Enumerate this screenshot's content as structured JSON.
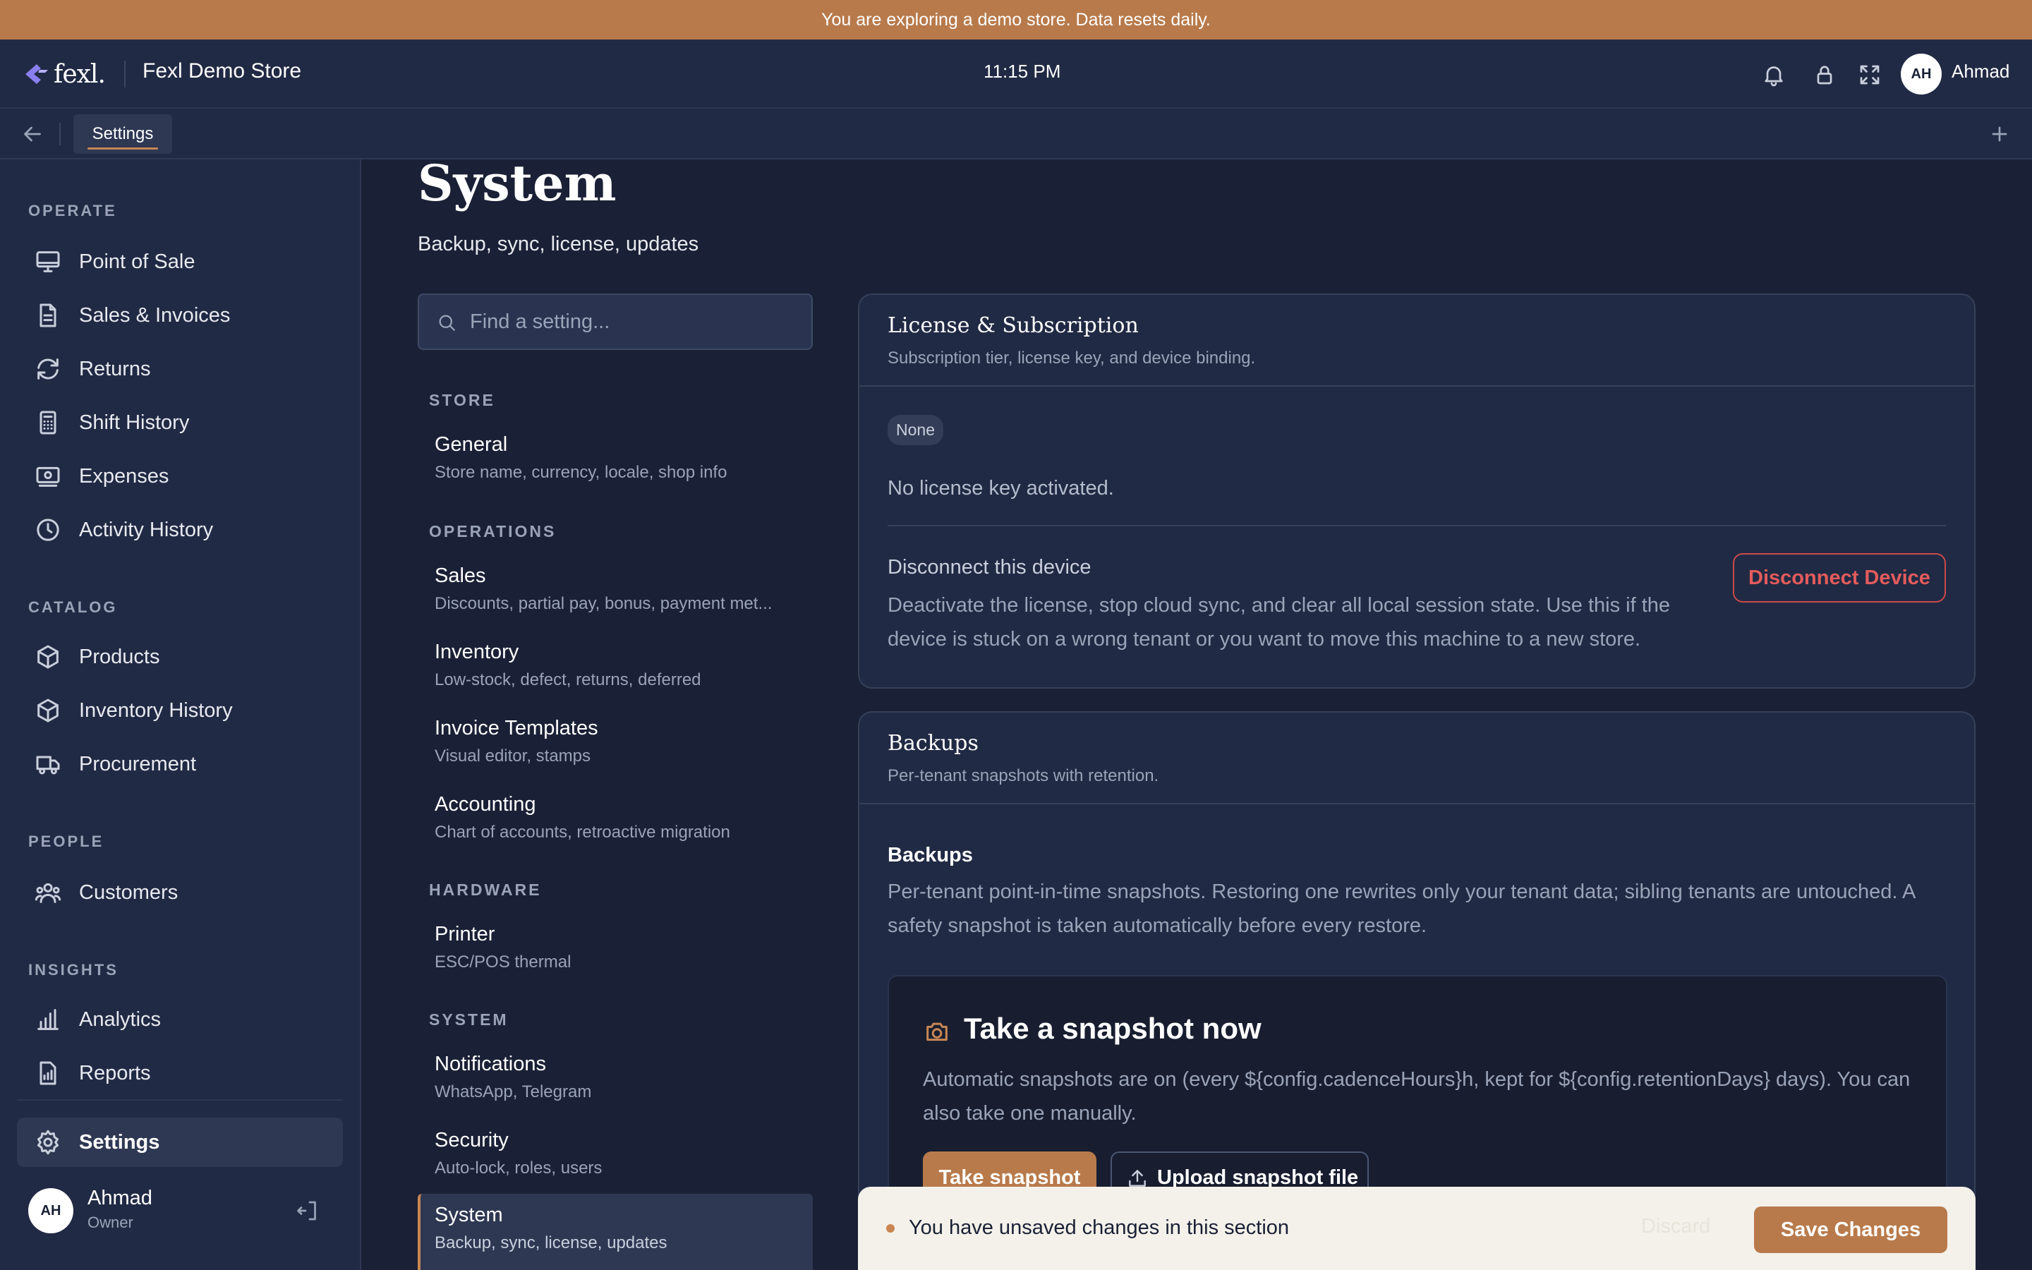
{
  "banner": {
    "text": "You are exploring a demo store. Data resets daily."
  },
  "header": {
    "logo_text": "fexl.",
    "store_name": "Fexl Demo Store",
    "clock": "11:15 PM",
    "user_initials": "AH",
    "user_name": "Ahmad",
    "icons": [
      "bell-icon",
      "lock-icon",
      "fullscreen-icon"
    ]
  },
  "tabbar": {
    "active_tab": "Settings"
  },
  "sidebar": {
    "sections": [
      {
        "title": "OPERATE",
        "items": [
          {
            "label": "Point of Sale",
            "icon": "monitor-icon"
          },
          {
            "label": "Sales & Invoices",
            "icon": "document-icon"
          },
          {
            "label": "Returns",
            "icon": "refresh-icon"
          },
          {
            "label": "Shift History",
            "icon": "calculator-icon"
          },
          {
            "label": "Expenses",
            "icon": "cash-icon"
          },
          {
            "label": "Activity History",
            "icon": "clock-icon"
          }
        ]
      },
      {
        "title": "CATALOG",
        "items": [
          {
            "label": "Products",
            "icon": "box-icon"
          },
          {
            "label": "Inventory History",
            "icon": "box-icon"
          },
          {
            "label": "Procurement",
            "icon": "truck-icon"
          }
        ]
      },
      {
        "title": "PEOPLE",
        "items": [
          {
            "label": "Customers",
            "icon": "users-icon"
          }
        ]
      },
      {
        "title": "INSIGHTS",
        "items": [
          {
            "label": "Analytics",
            "icon": "bar-chart-icon"
          },
          {
            "label": "Reports",
            "icon": "report-icon"
          }
        ]
      }
    ],
    "settings_label": "Settings",
    "user": {
      "initials": "AH",
      "name": "Ahmad",
      "role": "Owner"
    }
  },
  "page": {
    "title": "System",
    "subtitle": "Backup, sync, license, updates"
  },
  "search": {
    "placeholder": "Find a setting..."
  },
  "settings_nav": [
    {
      "category": "STORE",
      "items": [
        {
          "title": "General",
          "desc": "Store name, currency, locale, shop info"
        }
      ]
    },
    {
      "category": "OPERATIONS",
      "items": [
        {
          "title": "Sales",
          "desc": "Discounts, partial pay, bonus, payment met..."
        },
        {
          "title": "Inventory",
          "desc": "Low-stock, defect, returns, deferred"
        },
        {
          "title": "Invoice Templates",
          "desc": "Visual editor, stamps"
        },
        {
          "title": "Accounting",
          "desc": "Chart of accounts, retroactive migration"
        }
      ]
    },
    {
      "category": "HARDWARE",
      "items": [
        {
          "title": "Printer",
          "desc": "ESC/POS thermal"
        }
      ]
    },
    {
      "category": "SYSTEM",
      "items": [
        {
          "title": "Notifications",
          "desc": "WhatsApp, Telegram"
        },
        {
          "title": "Security",
          "desc": "Auto-lock, roles, users"
        },
        {
          "title": "System",
          "desc": "Backup, sync, license, updates"
        }
      ]
    }
  ],
  "license_card": {
    "title": "License & Subscription",
    "desc": "Subscription tier, license key, and device binding.",
    "badge": "None",
    "status": "No license key activated.",
    "disconnect_title": "Disconnect this device",
    "disconnect_desc": "Deactivate the license, stop cloud sync, and clear all local session state. Use this if the device is stuck on a wrong tenant or you want to move this machine to a new store.",
    "disconnect_button": "Disconnect Device"
  },
  "backups_card": {
    "title": "Backups",
    "desc": "Per-tenant snapshots with retention.",
    "section_title": "Backups",
    "section_desc": "Per-tenant point-in-time snapshots. Restoring one rewrites only your tenant data; sibling tenants are untouched. A safety snapshot is taken automatically before every restore.",
    "snapshot_title": "Take a snapshot now",
    "snapshot_desc": "Automatic snapshots are on (every ${config.cadenceHours}h, kept for ${config.retentionDays} days). You can also take one manually.",
    "take_button": "Take snapshot",
    "upload_button": "Upload snapshot file"
  },
  "unsaved_bar": {
    "text": "You have unsaved changes in this section",
    "discard": "Discard",
    "save": "Save Changes"
  }
}
